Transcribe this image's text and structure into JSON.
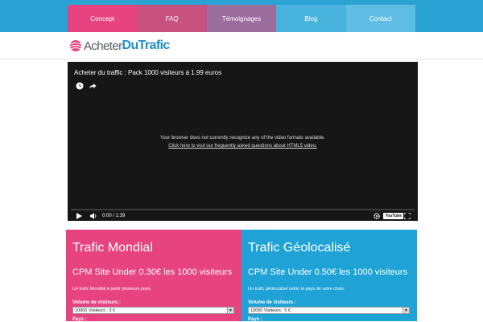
{
  "nav": {
    "items": [
      {
        "label": "Concept",
        "color": "#e6437f"
      },
      {
        "label": "FAQ",
        "color": "#c7527d"
      },
      {
        "label": "Témoignages",
        "color": "#9b6d9d"
      },
      {
        "label": "Blog",
        "color": "#48b3dc"
      },
      {
        "label": "Contact",
        "color": "#5fbde3"
      }
    ]
  },
  "logo": {
    "part1": "Acheter",
    "part2": "DuTrafic"
  },
  "video": {
    "title": "Acheter du traffic : Pack 1000 visiteurs à 1.99 euros",
    "message": "Your browser does not currently recognize any of the video formats available.",
    "link": "Click here to visit our frequently asked questions about HTML5 video.",
    "time": "0:00 / 1:39",
    "youtube": "YouTube"
  },
  "panels": [
    {
      "title": "Trafic Mondial",
      "price": "CPM Site Under 0.30€ les 1000 visiteurs",
      "desc": "Un trafic Mondial à partir plusieurs pays.",
      "label": "Volume de visiteurs :",
      "select": "10000 Visiteurs : 3 €",
      "label2": "Pays :",
      "color": "#e6437f"
    },
    {
      "title": "Trafic Géolocalisé",
      "price": "CPM Site Under 0.50€ les 1000 visiteurs",
      "desc": "Un trafic géolocalisé selon le pays de votre choix.",
      "label": "Volume de visiteurs :",
      "select": "10000 Visiteurs : 5 €",
      "label2": "Pays :",
      "color": "#1fa3d6"
    }
  ]
}
